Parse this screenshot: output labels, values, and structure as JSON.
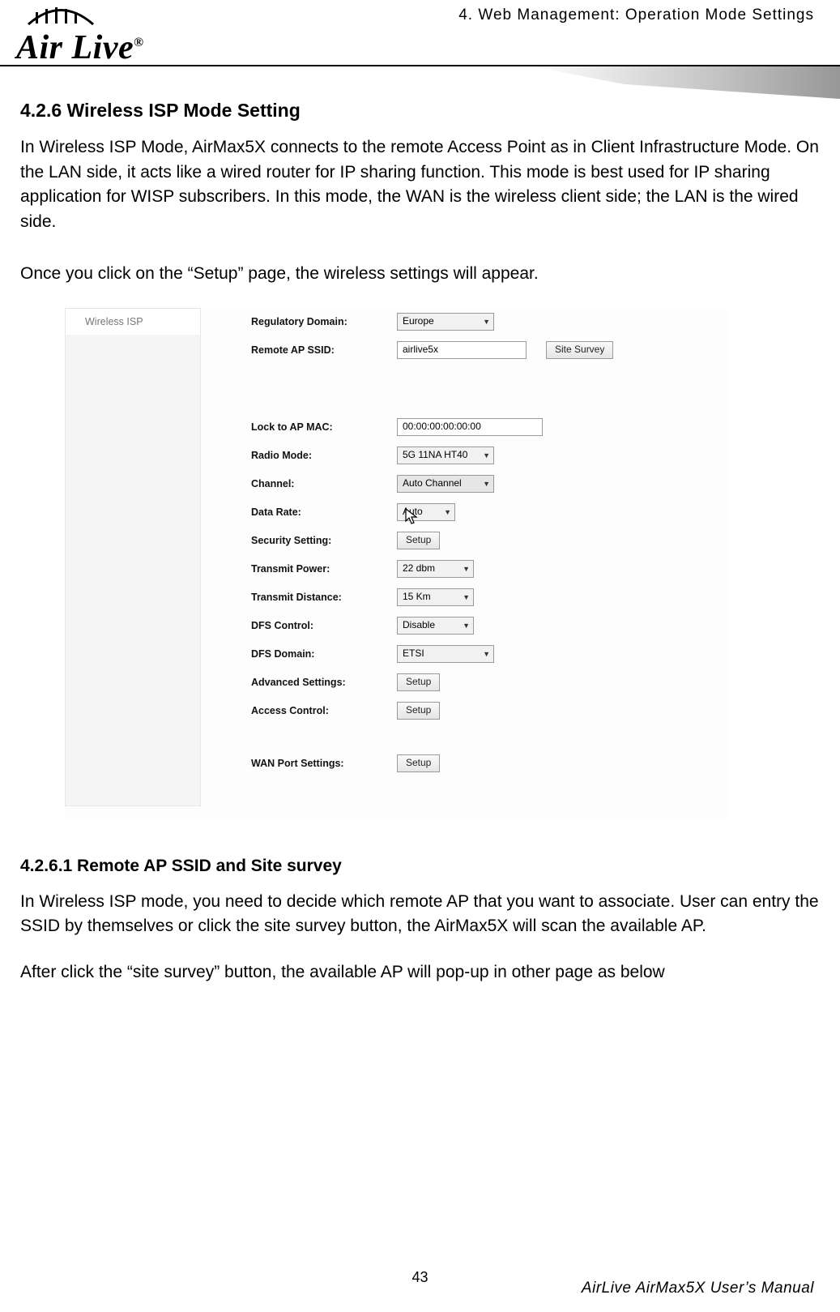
{
  "header": {
    "chapter": "4. Web Management: Operation Mode Settings",
    "logo_text": "Air Live",
    "logo_reg": "®"
  },
  "section": {
    "number_title": "4.2.6 Wireless ISP Mode Setting",
    "para1": "In Wireless ISP Mode, AirMax5X connects to the remote Access Point as in Client Infrastructure Mode. On the LAN side, it acts like a wired router for IP sharing function. This mode is best used for IP sharing application for WISP subscribers. In this mode, the WAN is the wireless client side; the LAN is the wired side.",
    "para2": "Once you click on the “Setup” page, the wireless settings will appear."
  },
  "screenshot": {
    "sidebar_item": "Wireless ISP",
    "fields": {
      "regulatory_domain_label": "Regulatory Domain:",
      "regulatory_domain_value": "Europe",
      "remote_ap_ssid_label": "Remote AP SSID:",
      "remote_ap_ssid_value": "airlive5x",
      "site_survey_btn": "Site Survey",
      "lock_mac_label": "Lock to AP MAC:",
      "lock_mac_value": "00:00:00:00:00:00",
      "radio_mode_label": "Radio Mode:",
      "radio_mode_value": "5G 11NA HT40",
      "channel_label": "Channel:",
      "channel_value": "Auto Channel",
      "data_rate_label": "Data Rate:",
      "data_rate_value": "Auto",
      "security_label": "Security Setting:",
      "security_btn": "Setup",
      "tx_power_label": "Transmit Power:",
      "tx_power_value": "22 dbm",
      "tx_distance_label": "Transmit Distance:",
      "tx_distance_value": "15 Km",
      "dfs_control_label": "DFS Control:",
      "dfs_control_value": "Disable",
      "dfs_domain_label": "DFS Domain:",
      "dfs_domain_value": "ETSI",
      "advanced_label": "Advanced Settings:",
      "advanced_btn": "Setup",
      "access_control_label": "Access Control:",
      "access_control_btn": "Setup",
      "wan_port_label": "WAN Port Settings:",
      "wan_port_btn": "Setup"
    }
  },
  "subsection": {
    "number_title": "4.2.6.1 Remote AP SSID and Site survey",
    "para1": "In Wireless ISP mode, you need to decide which remote AP that you want to associate. User can entry the SSID by themselves or click the site survey button, the AirMax5X will scan the available AP.",
    "para2": "After click the “site survey” button, the available AP will pop-up in other page as below"
  },
  "footer": {
    "page_number": "43",
    "manual": "AirLive AirMax5X User’s Manual"
  }
}
